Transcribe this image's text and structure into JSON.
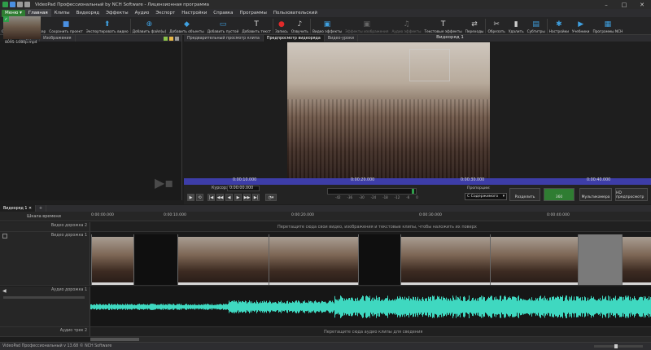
{
  "window": {
    "title": "VideoPad Профессиональный by NCH Software - Лицензионная программа"
  },
  "menu": {
    "menu_button": "Меню",
    "items": [
      "Главная",
      "Клипы",
      "Видеоряд",
      "Эффекты",
      "Аудио",
      "Экспорт",
      "Настройки",
      "Справка",
      "Программы",
      "Пользовательский"
    ]
  },
  "toolbar": {
    "buttons": [
      {
        "label": "Открыть",
        "icon": "folder-icon",
        "color": "#e8b84a"
      },
      {
        "label": "Видеомейкер",
        "icon": "magic-wand-icon",
        "color": "#d8d8d8"
      },
      {
        "label": "Сохранить проект",
        "icon": "save-icon",
        "color": "#4a90e2"
      },
      {
        "label": "Экспортировать видео",
        "icon": "export-icon",
        "color": "#3fa0e0"
      },
      {
        "label": "Добавить файл(ы)",
        "icon": "add-file-icon",
        "color": "#3fa0e0"
      },
      {
        "label": "Добавить объекты",
        "icon": "add-objects-icon",
        "color": "#3fa0e0"
      },
      {
        "label": "Добавить пустой",
        "icon": "add-blank-icon",
        "color": "#3fa0e0"
      },
      {
        "label": "Добавить текст",
        "icon": "add-text-icon",
        "color": "#dddddd"
      },
      {
        "label": "Запись",
        "icon": "record-icon",
        "color": "#e02a2a"
      },
      {
        "label": "Озвучить",
        "icon": "narrate-icon",
        "color": "#cccccc"
      },
      {
        "label": "Видео эффекты",
        "icon": "video-effects-icon",
        "color": "#3fa0e0"
      },
      {
        "label": "Эффекты изображения",
        "icon": "image-effects-icon",
        "color": "#666666"
      },
      {
        "label": "Аудио эффекты",
        "icon": "audio-effects-icon",
        "color": "#666666"
      },
      {
        "label": "Текстовые эффекты",
        "icon": "text-effects-icon",
        "color": "#dddddd"
      },
      {
        "label": "Переходы",
        "icon": "transitions-icon",
        "color": "#cccccc"
      },
      {
        "label": "Обрезать",
        "icon": "crop-icon",
        "color": "#cccccc"
      },
      {
        "label": "Удалить",
        "icon": "delete-icon",
        "color": "#cccccc"
      },
      {
        "label": "Субтитры",
        "icon": "subtitles-icon",
        "color": "#3fa0e0"
      },
      {
        "label": "Настройки",
        "icon": "settings-icon",
        "color": "#3fa0e0"
      },
      {
        "label": "Учебники",
        "icon": "tutorials-icon",
        "color": "#3fa0e0"
      },
      {
        "label": "Программы NCH",
        "icon": "nch-suite-icon",
        "color": "#3fa0e0"
      }
    ]
  },
  "bin": {
    "tabs": [
      "Видео",
      "Аудио",
      "Изображения"
    ],
    "files": [
      {
        "name": "8095-1080p.mp4"
      }
    ]
  },
  "preview": {
    "tabs": [
      "Предварительный просмотр клипа",
      "Предпросмотр видеоряда",
      "Видео-уроки"
    ],
    "title": "Видеоряд 1",
    "scrub_times": [
      "0:00:10.000",
      "0:00:20.000",
      "0:00:30.000",
      "0:00:40.000"
    ],
    "cursor_label": "Курсор:",
    "cursor_value": "0:00:00.000",
    "meter_ticks": [
      "-42",
      "-36",
      "-30",
      "-24",
      "-18",
      "-12",
      "-6",
      "0"
    ],
    "ratio_label": "Пропорции:",
    "ratio_value": "С Содержимого",
    "split_label": "Разделить",
    "label_360": "360",
    "multicam_label": "Мультикамера",
    "hd_label": "HD предпросмотр"
  },
  "timeline": {
    "tab": "Видеоряд 1",
    "ruler_label": "Шкала времени",
    "ruler_times": [
      "0:00:00.000",
      "0:00:10.000",
      "0:00:20.000",
      "0:00:30.000",
      "0:00:40.000"
    ],
    "video_track_2": "Видео дорожка 2",
    "overlay_hint": "Перетащите сюда свои видео, изображения и текстовые клипы, чтобы наложить их поверх",
    "video_track_1": "Видео дорожка 1",
    "audio_track_1": "Аудио дорожка 1",
    "audio_track_2": "Аудио трек 2",
    "audio_hint": "Перетащите сюда аудио клипы для сведения",
    "waveform_color": "#3fd8c0"
  },
  "status": {
    "text": "VideoPad Профессиональный v 13.68 © NCH Software"
  }
}
